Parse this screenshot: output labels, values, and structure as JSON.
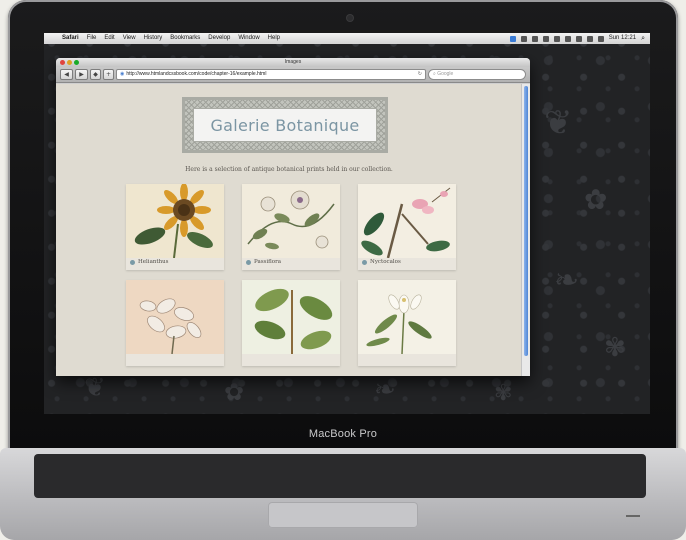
{
  "menubar": {
    "app": "Safari",
    "menus": [
      "File",
      "Edit",
      "View",
      "History",
      "Bookmarks",
      "Develop",
      "Window",
      "Help"
    ],
    "clock": "Sun 12:21"
  },
  "window": {
    "title": "Images",
    "url": "http://www.htmlandcssbook.com/code/chapter-16/example.html",
    "search_placeholder": "Google"
  },
  "page": {
    "title": "Galerie Botanique",
    "intro": "Here is a selection of antique botanical prints held in our collection.",
    "prints": [
      {
        "caption": "Helianthus"
      },
      {
        "caption": "Passiflora"
      },
      {
        "caption": "Nyctocalos"
      },
      {
        "caption": ""
      },
      {
        "caption": ""
      },
      {
        "caption": ""
      }
    ]
  },
  "laptop": {
    "brand": "MacBook Pro"
  },
  "colors": {
    "title_text": "#7b95a3",
    "page_background": "#dfdbd1",
    "caption_dot": "#7a9aa6"
  }
}
